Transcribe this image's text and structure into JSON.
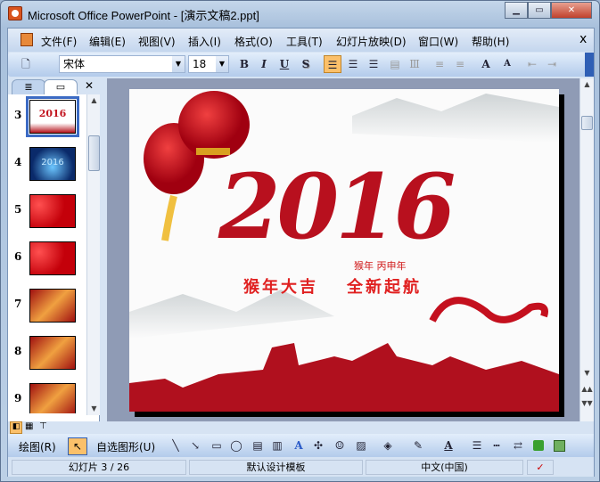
{
  "window": {
    "title": "Microsoft Office PowerPoint - [演示文稿2.ppt]",
    "min": "▁",
    "max": "▭",
    "close": "✕"
  },
  "menu": [
    "文件(F)",
    "编辑(E)",
    "视图(V)",
    "插入(I)",
    "格式(O)",
    "工具(T)",
    "幻灯片放映(D)",
    "窗口(W)",
    "帮助(H)"
  ],
  "menu_close": "x",
  "toolbar": {
    "font": "宋体",
    "size": "18",
    "bold": "B",
    "italic": "I",
    "underline": "U",
    "shadow": "S",
    "grow": "A",
    "shrink": "A"
  },
  "pane": {
    "close": "✕",
    "slides": [
      {
        "n": "3"
      },
      {
        "n": "4"
      },
      {
        "n": "5"
      },
      {
        "n": "6"
      },
      {
        "n": "7"
      },
      {
        "n": "8"
      },
      {
        "n": "9"
      }
    ]
  },
  "slide": {
    "year": "2016",
    "sub": "猴年 丙申年",
    "left": "猴年大吉",
    "right": "全新起航"
  },
  "drawbar": {
    "draw": "绘图(R)",
    "autoshapes": "自选图形(U)"
  },
  "status": {
    "slide": "幻灯片 3 / 26",
    "template": "默认设计模板",
    "lang": "中文(中国)"
  }
}
